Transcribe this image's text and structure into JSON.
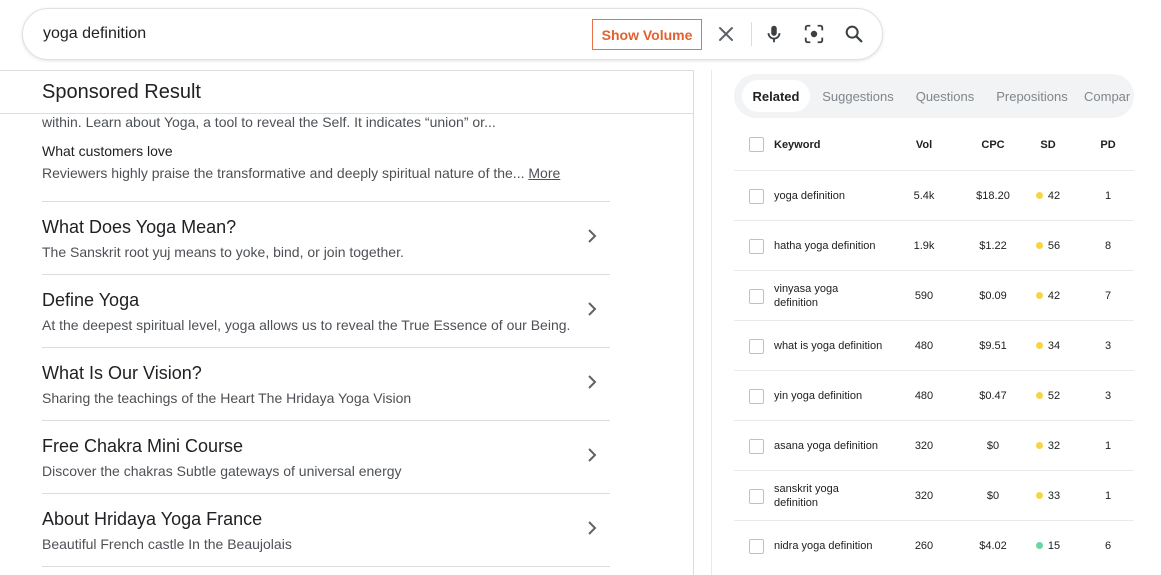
{
  "search": {
    "query": "yoga definition",
    "show_volume_label": "Show Volume"
  },
  "result": {
    "sponsored_title": "Sponsored Result",
    "snippet": "within. Learn about Yoga, a tool to reveal the Self. It indicates “union” or...",
    "customers_heading": "What customers love",
    "customers_text": "Reviewers highly praise the transformative and deeply spiritual nature of the...",
    "more_label": "More",
    "sitelinks": [
      {
        "title": "What Does Yoga Mean?",
        "desc": "The Sanskrit root yuj means to yoke, bind, or join together."
      },
      {
        "title": "Define Yoga",
        "desc": "At the deepest spiritual level, yoga allows us to reveal the True Essence of our Being."
      },
      {
        "title": "What Is Our Vision?",
        "desc": "Sharing the teachings of the Heart The Hridaya Yoga Vision"
      },
      {
        "title": "Free Chakra Mini Course",
        "desc": "Discover the chakras Subtle gateways of universal energy"
      },
      {
        "title": "About Hridaya Yoga France",
        "desc": "Beautiful French castle In the Beaujolais"
      }
    ]
  },
  "panel": {
    "tabs": [
      "Related",
      "Suggestions",
      "Questions",
      "Prepositions",
      "Compar"
    ],
    "active_tab": "Related",
    "columns": {
      "keyword": "Keyword",
      "vol": "Vol",
      "cpc": "CPC",
      "sd": "SD",
      "pd": "PD"
    },
    "rows": [
      {
        "keyword": "yoga definition",
        "vol": "5.4k",
        "cpc": "$18.20",
        "sd": "42",
        "sd_color": "#f5d547",
        "pd": "1"
      },
      {
        "keyword": "hatha yoga definition",
        "vol": "1.9k",
        "cpc": "$1.22",
        "sd": "56",
        "sd_color": "#f5d547",
        "pd": "8"
      },
      {
        "keyword": "vinyasa yoga definition",
        "vol": "590",
        "cpc": "$0.09",
        "sd": "42",
        "sd_color": "#f5d547",
        "pd": "7"
      },
      {
        "keyword": "what is yoga definition",
        "vol": "480",
        "cpc": "$9.51",
        "sd": "34",
        "sd_color": "#f5d547",
        "pd": "3"
      },
      {
        "keyword": "yin yoga definition",
        "vol": "480",
        "cpc": "$0.47",
        "sd": "52",
        "sd_color": "#f5d547",
        "pd": "3"
      },
      {
        "keyword": "asana yoga definition",
        "vol": "320",
        "cpc": "$0",
        "sd": "32",
        "sd_color": "#f5d547",
        "pd": "1"
      },
      {
        "keyword": "sanskrit yoga definition",
        "vol": "320",
        "cpc": "$0",
        "sd": "33",
        "sd_color": "#f5d547",
        "pd": "1"
      },
      {
        "keyword": "nidra yoga definition",
        "vol": "260",
        "cpc": "$4.02",
        "sd": "15",
        "sd_color": "#6fd3a4",
        "pd": "6"
      }
    ]
  }
}
